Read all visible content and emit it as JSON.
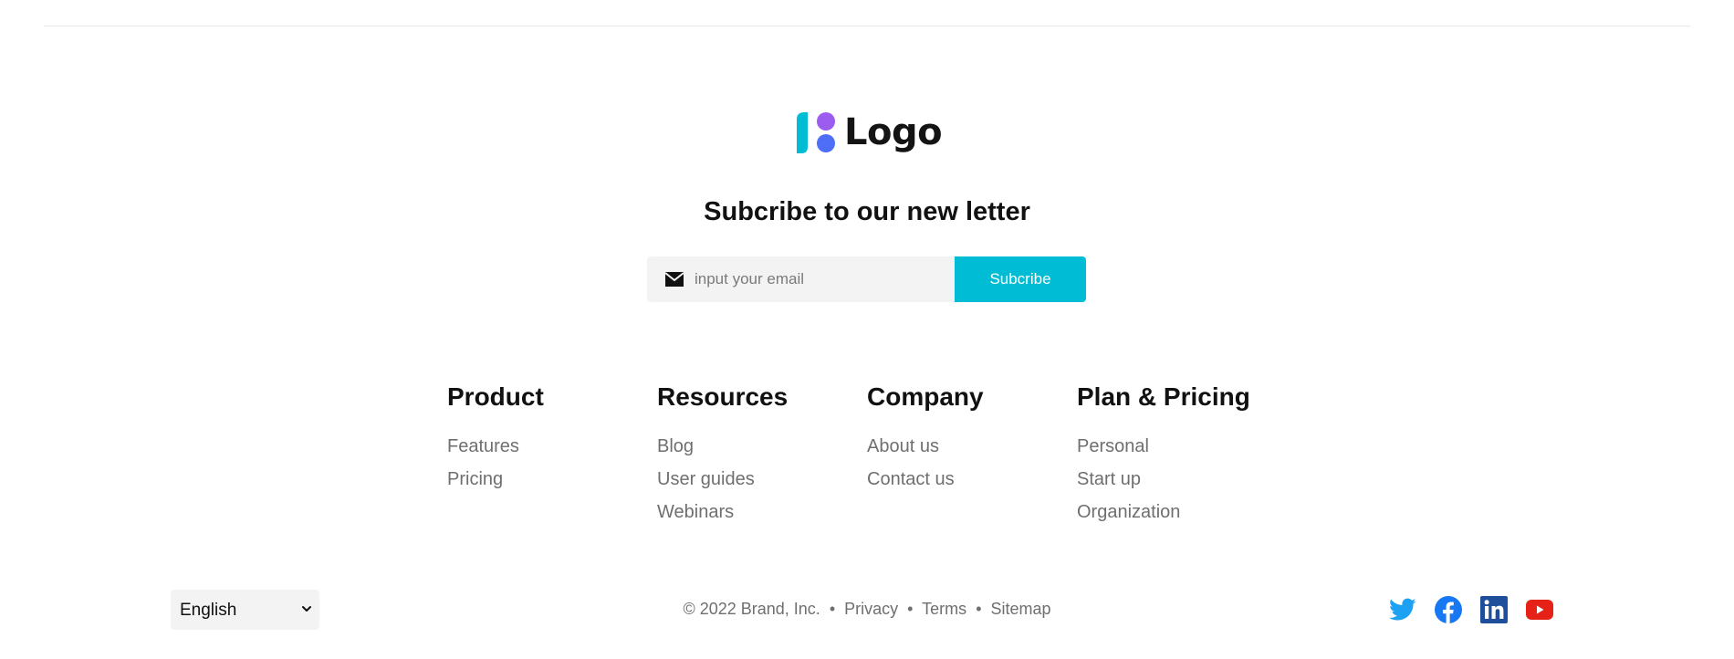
{
  "logo": {
    "text": "Logo",
    "colors": {
      "bar": "#00bcd4",
      "dot_top": "#9c5cf0",
      "dot_bottom": "#4f6ef7"
    }
  },
  "newsletter": {
    "title": "Subcribe to our new letter",
    "email_placeholder": "input your email",
    "email_value": "",
    "subscribe_label": "Subcribe",
    "accent_color": "#00bcd4"
  },
  "columns": [
    {
      "heading": "Product",
      "links": [
        "Features",
        "Pricing"
      ]
    },
    {
      "heading": "Resources",
      "links": [
        "Blog",
        "User guides",
        "Webinars"
      ]
    },
    {
      "heading": "Company",
      "links": [
        "About us",
        "Contact us"
      ]
    },
    {
      "heading": "Plan & Pricing",
      "links": [
        "Personal",
        "Start up",
        "Organization"
      ]
    }
  ],
  "footer": {
    "language_selected": "English",
    "copyright": "© 2022 Brand, Inc.",
    "links": [
      "Privacy",
      "Terms",
      "Sitemap"
    ],
    "separator": "•"
  },
  "socials": [
    {
      "icon": "twitter-icon",
      "color": "#1da1f2"
    },
    {
      "icon": "facebook-icon",
      "color": "#1877f2"
    },
    {
      "icon": "linkedin-icon",
      "color": "#1f4f9b"
    },
    {
      "icon": "youtube-icon",
      "color": "#e62117"
    }
  ]
}
